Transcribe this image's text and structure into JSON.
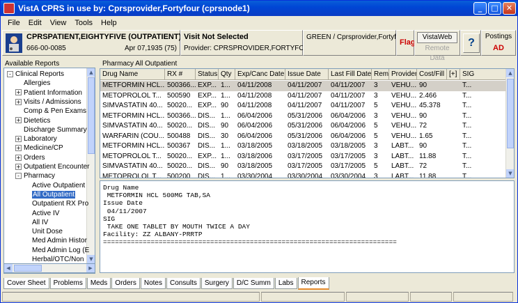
{
  "window": {
    "title": "VistA CPRS in use by: Cprsprovider,Fortyfour  (cprsnode1)"
  },
  "menu": [
    "File",
    "Edit",
    "View",
    "Tools",
    "Help"
  ],
  "patient": {
    "name": "CPRSPATIENT,EIGHTYFIVE (OUTPATIENT)",
    "ssn": "666-00-0085",
    "dob": "Apr 07,1935 (75)"
  },
  "visit": {
    "title": "Visit Not Selected",
    "provider": "Provider:  CPRSPROVIDER,FORTYFOUR"
  },
  "team": "GREEN / Cprsprovider,Fortyfour",
  "flag_label": "Flag",
  "vistaweb_label": "VistaWeb",
  "remote_label": "Remote Data",
  "help_glyph": "?",
  "postings": {
    "label": "Postings",
    "value": "AD"
  },
  "reports_label": "Available Reports",
  "tree": [
    {
      "label": "Clinical Reports",
      "indent": 0,
      "exp": "-"
    },
    {
      "label": "Allergies",
      "indent": 1,
      "exp": ""
    },
    {
      "label": "Patient Information",
      "indent": 1,
      "exp": "+"
    },
    {
      "label": "Visits / Admissions",
      "indent": 1,
      "exp": "+"
    },
    {
      "label": "Comp & Pen Exams",
      "indent": 1,
      "exp": ""
    },
    {
      "label": "Dietetics",
      "indent": 1,
      "exp": "+"
    },
    {
      "label": "Discharge Summary",
      "indent": 1,
      "exp": ""
    },
    {
      "label": "Laboratory",
      "indent": 1,
      "exp": "+"
    },
    {
      "label": "Medicine/CP",
      "indent": 1,
      "exp": "+"
    },
    {
      "label": "Orders",
      "indent": 1,
      "exp": "+"
    },
    {
      "label": "Outpatient Encounter",
      "indent": 1,
      "exp": "+"
    },
    {
      "label": "Pharmacy",
      "indent": 1,
      "exp": "-"
    },
    {
      "label": "Active Outpatient",
      "indent": 2,
      "exp": ""
    },
    {
      "label": "All Outpatient",
      "indent": 2,
      "exp": "",
      "selected": true
    },
    {
      "label": "Outpatient RX Pro",
      "indent": 2,
      "exp": ""
    },
    {
      "label": "Active IV",
      "indent": 2,
      "exp": ""
    },
    {
      "label": "All IV",
      "indent": 2,
      "exp": ""
    },
    {
      "label": "Unit Dose",
      "indent": 2,
      "exp": ""
    },
    {
      "label": "Med Admin Histor",
      "indent": 2,
      "exp": ""
    },
    {
      "label": "Med Admin Log (E",
      "indent": 2,
      "exp": ""
    },
    {
      "label": "Herbal/OTC/Non",
      "indent": 2,
      "exp": ""
    }
  ],
  "report_title": "Pharmacy All Outpatient",
  "columns": [
    "Drug Name",
    "RX #",
    "Status",
    "Qty",
    "Exp/Canc Date",
    "Issue Date",
    "Last Fill Date",
    "Rem",
    "Provider",
    "Cost/Fill",
    "[+]",
    "SIG"
  ],
  "rows": [
    [
      "METFORMIN HCL...",
      "500366...",
      "EXP...",
      "1...",
      "04/11/2008",
      "04/11/2007",
      "04/11/2007",
      "3",
      "VEHU...",
      "90",
      "",
      "T..."
    ],
    [
      "METOPROLOL T...",
      "500590",
      "EXP...",
      "1...",
      "04/11/2008",
      "04/11/2007",
      "04/11/2007",
      "3",
      "VEHU...",
      "2.466",
      "",
      "T..."
    ],
    [
      "SIMVASTATIN 40...",
      "50020...",
      "EXP...",
      "90",
      "04/11/2008",
      "04/11/2007",
      "04/11/2007",
      "5",
      "VEHU...",
      "45.378",
      "",
      "T..."
    ],
    [
      "METFORMIN HCL...",
      "500366...",
      "DIS...",
      "1...",
      "06/04/2006",
      "05/31/2006",
      "06/04/2006",
      "3",
      "VEHU...",
      "90",
      "",
      "T..."
    ],
    [
      "SIMVASTATIN 40...",
      "50020...",
      "DIS...",
      "90",
      "06/04/2006",
      "05/31/2006",
      "06/04/2006",
      "5",
      "VEHU...",
      "72",
      "",
      "T..."
    ],
    [
      "WARFARIN (COU...",
      "500488",
      "DIS...",
      "30",
      "06/04/2006",
      "05/31/2006",
      "06/04/2006",
      "5",
      "VEHU...",
      "1.65",
      "",
      "T..."
    ],
    [
      "METFORMIN HCL...",
      "500367",
      "DIS...",
      "1...",
      "03/18/2005",
      "03/18/2005",
      "03/18/2005",
      "3",
      "LABT...",
      "90",
      "",
      "T..."
    ],
    [
      "METOPROLOL T...",
      "50020...",
      "EXP...",
      "1...",
      "03/18/2006",
      "03/17/2005",
      "03/17/2005",
      "3",
      "LABT...",
      "11.88",
      "",
      "T..."
    ],
    [
      "SIMVASTATIN 40...",
      "50020...",
      "DIS...",
      "90",
      "03/18/2005",
      "03/17/2005",
      "03/17/2005",
      "5",
      "LABT...",
      "72",
      "",
      "T..."
    ],
    [
      "METOPROLOL T...",
      "500200",
      "DIS...",
      "1...",
      "03/30/2004",
      "03/30/2004",
      "03/30/2004",
      "3",
      "LABT...",
      "11.88",
      "",
      "T..."
    ]
  ],
  "detail_lines": [
    "Drug Name",
    " METFORMIN HCL 500MG TAB,SA",
    "Issue Date",
    " 04/11/2007",
    "SIG",
    " TAKE ONE TABLET BY MOUTH TWICE A DAY",
    "Facility: ZZ ALBANY-PRRTP",
    "=========================================================================="
  ],
  "tabs": [
    "Cover Sheet",
    "Problems",
    "Meds",
    "Orders",
    "Notes",
    "Consults",
    "Surgery",
    "D/C Summ",
    "Labs",
    "Reports"
  ],
  "active_tab": "Reports"
}
